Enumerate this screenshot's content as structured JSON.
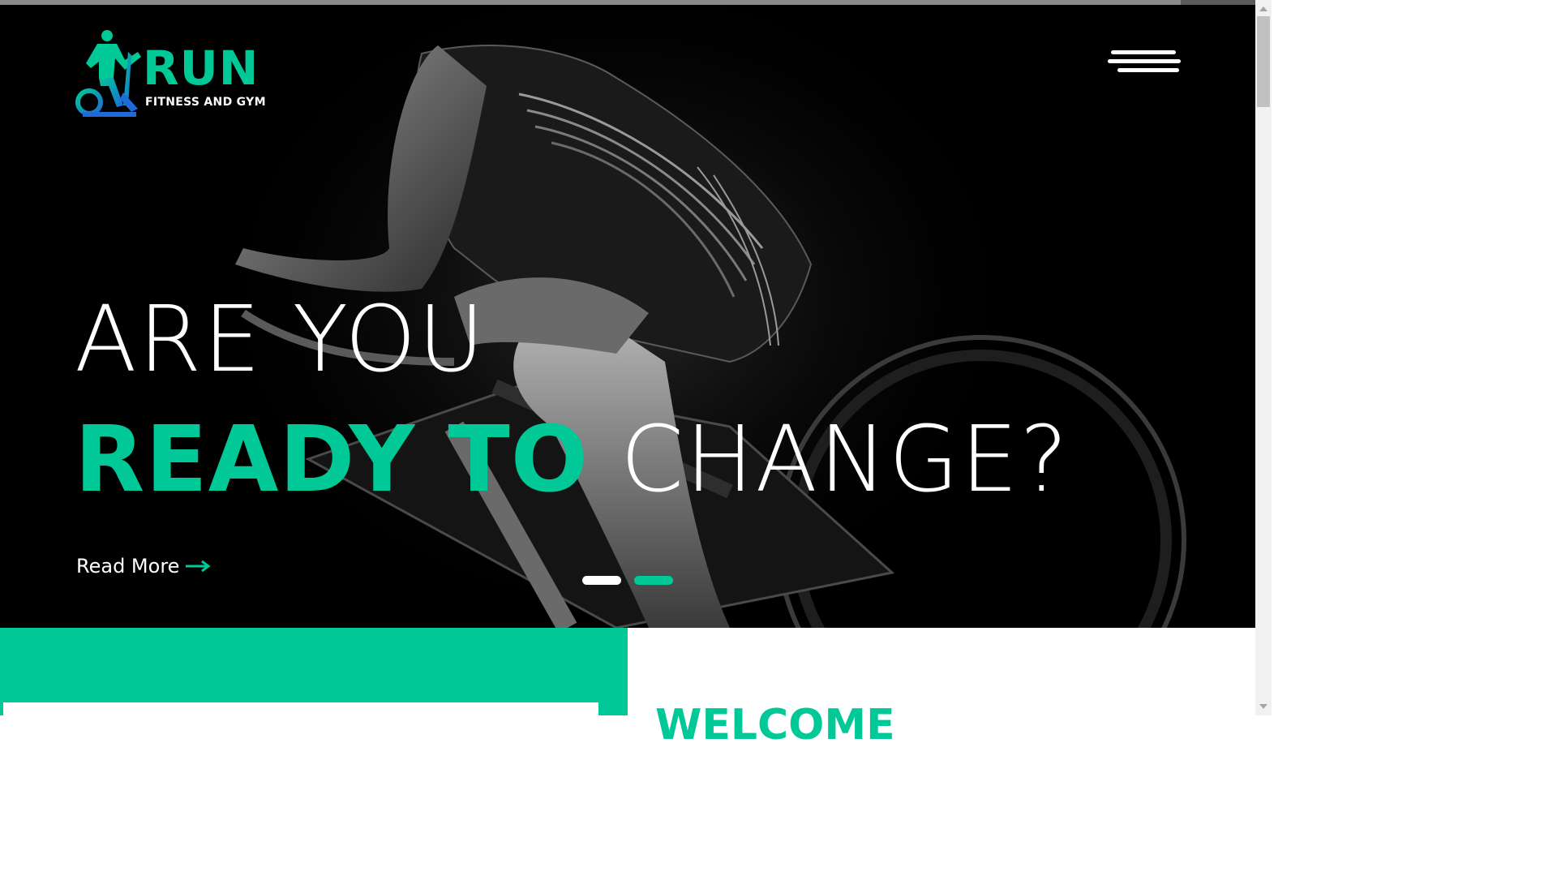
{
  "brand": {
    "name": "RUN",
    "tagline": "FITNESS AND GYM"
  },
  "hero": {
    "headline_line1": "ARE YOU",
    "headline_accent": "READY TO",
    "headline_rest": "CHANGE?",
    "cta_label": "Read More",
    "slides": [
      {
        "label": "slide-1",
        "active": true
      },
      {
        "label": "slide-2",
        "active": false
      }
    ]
  },
  "about": {
    "heading_partial": "WELCOME"
  },
  "icons": {
    "menu": "hamburger-menu-icon",
    "arrow": "arrow-right-icon",
    "logo": "exercise-bike-icon"
  },
  "colors": {
    "accent": "#00c896",
    "hero_bg": "#000000",
    "text_light": "#ffffff",
    "dot_active": "#ffffff",
    "dot_inactive": "#00c896"
  }
}
